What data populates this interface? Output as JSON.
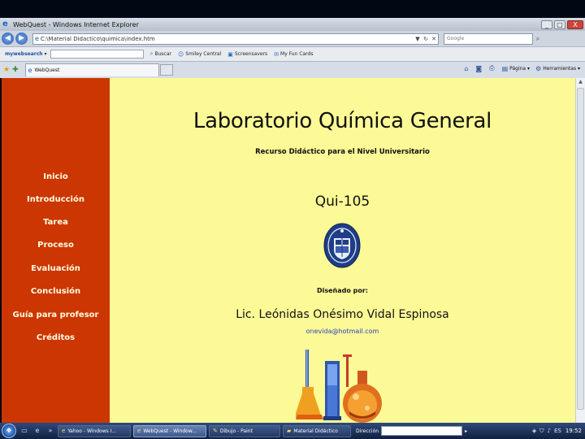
{
  "window": {
    "title": "WebQuest - Windows Internet Explorer",
    "controls": [
      "_",
      "□",
      "X"
    ]
  },
  "address_bar": {
    "url": "C:\\Material Didactico\\quimica\\index.htm",
    "search_placeholder": "Google"
  },
  "toolbar": {
    "brand": "mywebsearch",
    "items": [
      {
        "label": "Buscar",
        "icon": "search-icon"
      },
      {
        "label": "Smiley Central",
        "icon": "smiley-icon"
      },
      {
        "label": "Screensavers",
        "icon": "screensaver-icon"
      },
      {
        "label": "My Fun Cards",
        "icon": "cards-icon"
      }
    ]
  },
  "tabs": {
    "active_label": "WebQuest"
  },
  "commands": {
    "page_label": "Página",
    "tools_label": "Herramientas"
  },
  "sidebar": {
    "items": [
      {
        "label": "Inicio"
      },
      {
        "label": "Introducción"
      },
      {
        "label": "Tarea"
      },
      {
        "label": "Proceso"
      },
      {
        "label": "Evaluación"
      },
      {
        "label": "Conclusión"
      },
      {
        "label": "Guía para profesor"
      },
      {
        "label": "Créditos"
      }
    ]
  },
  "main": {
    "title": "Laboratorio Química General",
    "subtitle": "Recurso Didáctico para el Nivel Universitario",
    "course_code": "Qui-105",
    "designed_by": "Diseñado por:",
    "author": "Lic. Leónidas Onésimo Vidal Espinosa",
    "email": "onevida@hotmail.com"
  },
  "taskbar": {
    "tasks": [
      {
        "label": "Yahoo - Windows I...",
        "active": false
      },
      {
        "label": "WebQuest - Window...",
        "active": true
      },
      {
        "label": "Dibujo - Paint",
        "active": false
      },
      {
        "label": "Material Didáctico",
        "active": false
      }
    ],
    "address_label": "Dirección",
    "clock": "19:52"
  },
  "colors": {
    "sidebar_bg": "#cc3602",
    "content_bg": "#fcfa96",
    "nav_text": "#ffffe0",
    "email_text": "#2a3fbf"
  }
}
